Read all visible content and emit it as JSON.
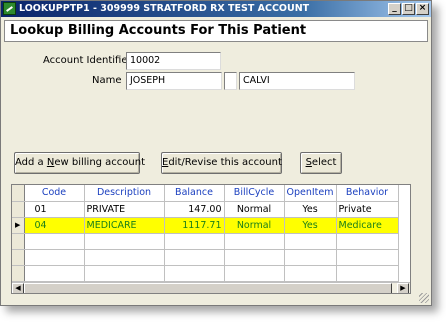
{
  "window": {
    "title": "LOOKUPPTP1 - 309999 STRATFORD RX TEST ACCOUNT"
  },
  "title_buttons": {
    "minimize": "_",
    "maximize": "□",
    "close": "×"
  },
  "header": {
    "title": "Lookup Billing Accounts For This Patient"
  },
  "form": {
    "account_identifier_label": "Account Identifier",
    "account_identifier_value": "10002",
    "name_label": "Name",
    "first_name": "JOSEPH",
    "middle_initial": "",
    "last_name": "CALVI"
  },
  "buttons": {
    "add": {
      "pre": "Add a ",
      "hot": "N",
      "post": "ew billing account"
    },
    "edit": {
      "pre": "",
      "hot": "E",
      "post": "dit/Revise this account"
    },
    "select": {
      "pre": "",
      "hot": "S",
      "post": "elect"
    }
  },
  "grid": {
    "columns": [
      "Code",
      "Description",
      "Balance",
      "BillCycle",
      "OpenItem",
      "Behavior"
    ],
    "rows": [
      {
        "code": "01",
        "description": "PRIVATE",
        "balance": "147.00",
        "billcycle": "Normal",
        "openitem": "Yes",
        "behavior": "Private",
        "selected": false
      },
      {
        "code": "04",
        "description": "MEDICARE",
        "balance": "1117.71",
        "billcycle": "Normal",
        "openitem": "Yes",
        "behavior": "Medicare",
        "selected": true
      }
    ],
    "empty_rows": 4,
    "row_indicator": "▶"
  },
  "colors": {
    "header_text": "#1a3fbf",
    "selected_bg": "#ffff00",
    "selected_text": "#1a7f1a"
  },
  "icons": [
    "app-icon",
    "minimize-icon",
    "maximize-icon",
    "close-icon",
    "row-pointer-icon",
    "scroll-left-icon",
    "scroll-right-icon"
  ]
}
